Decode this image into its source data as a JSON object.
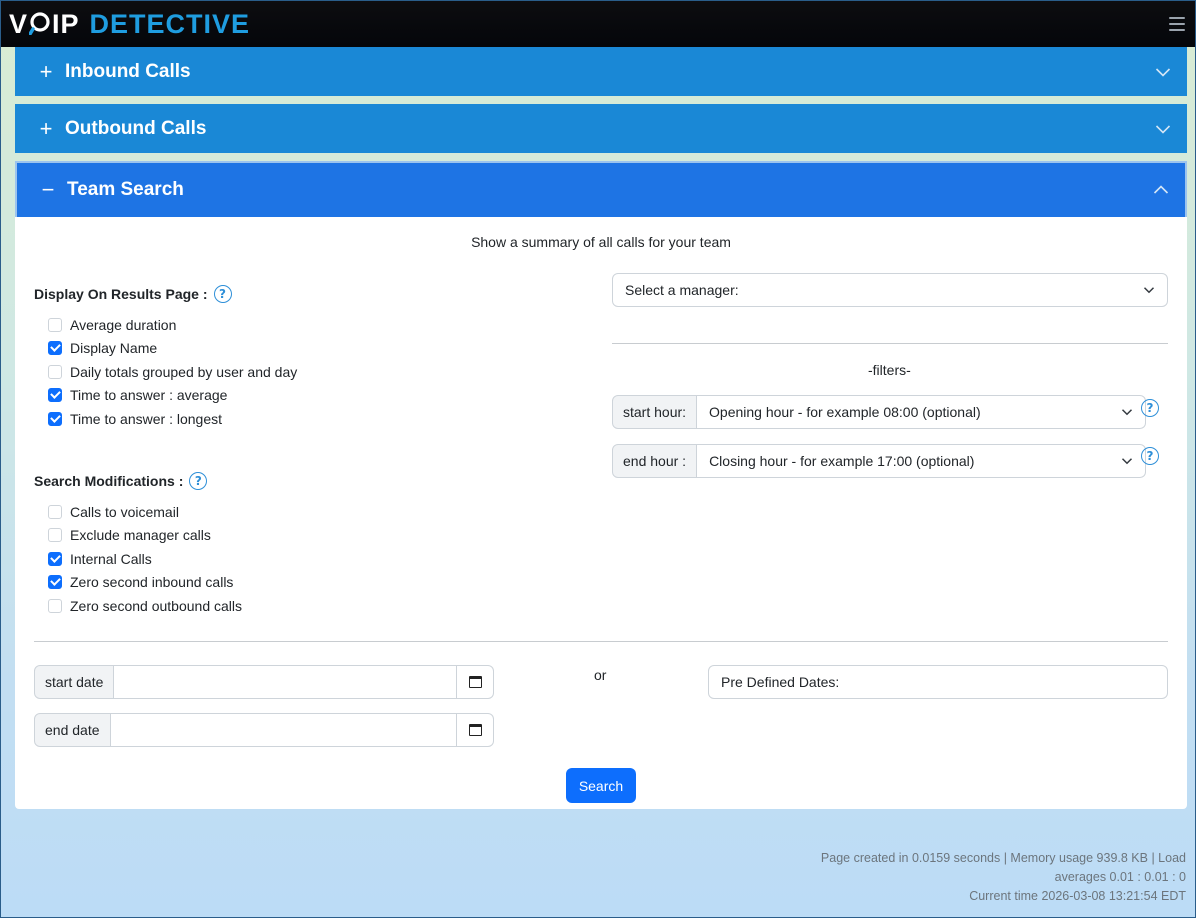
{
  "brand": {
    "part1": "V",
    "part2": "IP",
    "part3": "DETECTIVE"
  },
  "icons": {
    "menu": "hamburger-icon",
    "help": "question-circle-icon",
    "chevron": "chevron-icon",
    "calendar": "calendar-icon"
  },
  "colors": {
    "header_bg": "#04060a",
    "accordion": "#1a88d6",
    "accordion_active": "#1e74e4",
    "primary": "#0d6efd",
    "brand_blue": "#1f9de0"
  },
  "accordion": [
    {
      "sign": "+",
      "label": "Inbound Calls",
      "expanded": false
    },
    {
      "sign": "+",
      "label": "Outbound Calls",
      "expanded": false
    },
    {
      "sign": "−",
      "label": "Team Search",
      "expanded": true
    }
  ],
  "team_search": {
    "intro": "Show a summary of all calls for your team",
    "display": {
      "title": "Display On Results Page :",
      "help": "?",
      "options": [
        {
          "label": "Average duration",
          "checked": false
        },
        {
          "label": "Display Name",
          "checked": true
        },
        {
          "label": "Daily totals grouped by user and day",
          "checked": false
        },
        {
          "label": "Time to answer : average",
          "checked": true
        },
        {
          "label": "Time to answer : longest",
          "checked": true
        }
      ]
    },
    "mods": {
      "title": "Search Modifications :",
      "help": "?",
      "options": [
        {
          "label": "Calls to voicemail",
          "checked": false
        },
        {
          "label": "Exclude manager calls",
          "checked": false
        },
        {
          "label": "Internal Calls",
          "checked": true
        },
        {
          "label": "Zero second inbound calls",
          "checked": true
        },
        {
          "label": "Zero second outbound calls",
          "checked": false
        }
      ]
    },
    "manager_select": "Select a manager:",
    "filters_label": "-filters-",
    "start_hour": {
      "label": "start hour:",
      "value": "Opening hour - for example 08:00 (optional)"
    },
    "end_hour": {
      "label": "end hour :",
      "value": "Closing hour - for example 17:00 (optional)"
    },
    "start_date": {
      "label": "start date",
      "value": ""
    },
    "end_date": {
      "label": "end date",
      "value": ""
    },
    "or_label": "or",
    "predefined": "Pre Defined Dates:",
    "search_button": "Search"
  },
  "footer": {
    "line1": "Page created in 0.0159 seconds | Memory usage 939.8 KB | Load",
    "line2": "averages 0.01 : 0.01 : 0",
    "line3": "Current time 2026-03-08 13:21:54 EDT"
  }
}
